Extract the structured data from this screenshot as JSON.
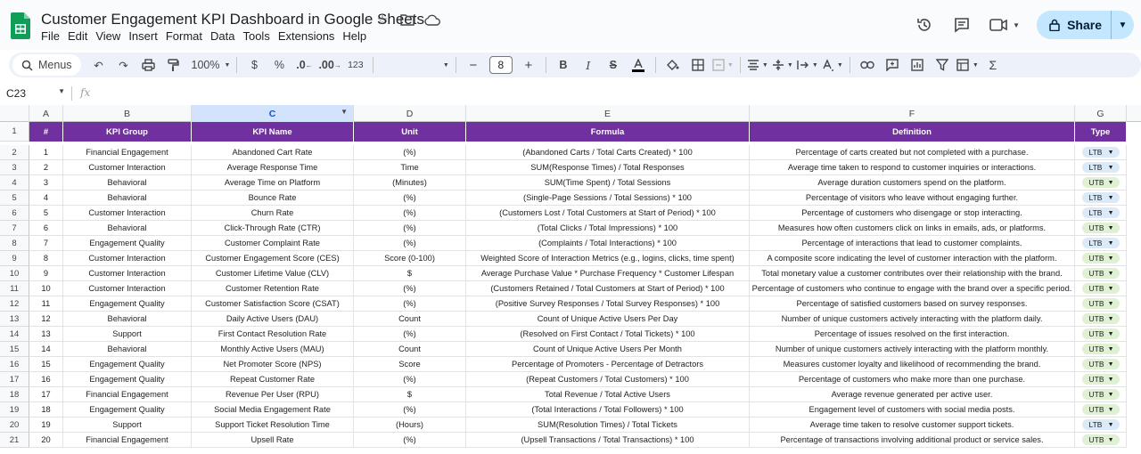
{
  "doc": {
    "title": "Customer Engagement KPI Dashboard in Google Sheets"
  },
  "menu": [
    "File",
    "Edit",
    "View",
    "Insert",
    "Format",
    "Data",
    "Tools",
    "Extensions",
    "Help"
  ],
  "share": {
    "label": "Share"
  },
  "toolbar": {
    "search_label": "Menus",
    "zoom": "100%",
    "currency": "$",
    "percent": "%",
    "dec_decrease": ".0",
    "dec_increase": ".00",
    "number_format": "123",
    "font_size": "8",
    "minus": "−",
    "plus": "+",
    "bold": "B",
    "italic": "I",
    "sigma": "Σ"
  },
  "formula_bar": {
    "cell_ref": "C23",
    "fx": "fx"
  },
  "columns": [
    "A",
    "B",
    "C",
    "D",
    "E",
    "F",
    "G"
  ],
  "headers": [
    "#",
    "KPI Group",
    "KPI Name",
    "Unit",
    "Formula",
    "Definition",
    "Type"
  ],
  "colors": {
    "header_bg": "#7030a0",
    "ltb_chip": "#dbeaf9",
    "utb_chip": "#dff0d3"
  },
  "rows": [
    {
      "n": "1",
      "group": "Financial Engagement",
      "name": "Abandoned Cart Rate",
      "unit": "(%)",
      "formula": "(Abandoned Carts / Total Carts Created) * 100",
      "definition": "Percentage of carts created but not completed with a purchase.",
      "type": "LTB"
    },
    {
      "n": "2",
      "group": "Customer Interaction",
      "name": "Average Response Time",
      "unit": "Time",
      "formula": "SUM(Response Times) / Total Responses",
      "definition": "Average time taken to respond to customer inquiries or interactions.",
      "type": "LTB"
    },
    {
      "n": "3",
      "group": "Behavioral",
      "name": "Average Time on Platform",
      "unit": "(Minutes)",
      "formula": "SUM(Time Spent) / Total Sessions",
      "definition": "Average duration customers spend on the platform.",
      "type": "UTB"
    },
    {
      "n": "4",
      "group": "Behavioral",
      "name": "Bounce Rate",
      "unit": "(%)",
      "formula": "(Single-Page Sessions / Total Sessions) * 100",
      "definition": "Percentage of visitors who leave without engaging further.",
      "type": "LTB"
    },
    {
      "n": "5",
      "group": "Customer Interaction",
      "name": "Churn Rate",
      "unit": "(%)",
      "formula": "(Customers Lost / Total Customers at Start of Period) * 100",
      "definition": "Percentage of customers who disengage or stop interacting.",
      "type": "LTB"
    },
    {
      "n": "6",
      "group": "Behavioral",
      "name": "Click-Through Rate (CTR)",
      "unit": "(%)",
      "formula": "(Total Clicks / Total Impressions) * 100",
      "definition": "Measures how often customers click on links in emails, ads, or platforms.",
      "type": "UTB"
    },
    {
      "n": "7",
      "group": "Engagement Quality",
      "name": "Customer Complaint Rate",
      "unit": "(%)",
      "formula": "(Complaints / Total Interactions) * 100",
      "definition": "Percentage of interactions that lead to customer complaints.",
      "type": "LTB"
    },
    {
      "n": "8",
      "group": "Customer Interaction",
      "name": "Customer Engagement Score (CES)",
      "unit": "Score (0-100)",
      "formula": "Weighted Score of Interaction Metrics (e.g., logins, clicks, time spent)",
      "definition": "A composite score indicating the level of customer interaction with the platform.",
      "type": "UTB"
    },
    {
      "n": "9",
      "group": "Customer Interaction",
      "name": "Customer Lifetime Value (CLV)",
      "unit": "$",
      "formula": "Average Purchase Value * Purchase Frequency * Customer Lifespan",
      "definition": "Total monetary value a customer contributes over their relationship with the brand.",
      "type": "UTB"
    },
    {
      "n": "10",
      "group": "Customer Interaction",
      "name": "Customer Retention Rate",
      "unit": "(%)",
      "formula": "(Customers Retained / Total Customers at Start of Period) * 100",
      "definition": "Percentage of customers who continue to engage with the brand over a specific period.",
      "type": "UTB"
    },
    {
      "n": "11",
      "group": "Engagement Quality",
      "name": "Customer Satisfaction Score (CSAT)",
      "unit": "(%)",
      "formula": "(Positive Survey Responses / Total Survey Responses) * 100",
      "definition": "Percentage of satisfied customers based on survey responses.",
      "type": "UTB"
    },
    {
      "n": "12",
      "group": "Behavioral",
      "name": "Daily Active Users (DAU)",
      "unit": "Count",
      "formula": "Count of Unique Active Users Per Day",
      "definition": "Number of unique customers actively interacting with the platform daily.",
      "type": "UTB"
    },
    {
      "n": "13",
      "group": "Support",
      "name": "First Contact Resolution Rate",
      "unit": "(%)",
      "formula": "(Resolved on First Contact / Total Tickets) * 100",
      "definition": "Percentage of issues resolved on the first interaction.",
      "type": "UTB"
    },
    {
      "n": "14",
      "group": "Behavioral",
      "name": "Monthly Active Users (MAU)",
      "unit": "Count",
      "formula": "Count of Unique Active Users Per Month",
      "definition": "Number of unique customers actively interacting with the platform monthly.",
      "type": "UTB"
    },
    {
      "n": "15",
      "group": "Engagement Quality",
      "name": "Net Promoter Score (NPS)",
      "unit": "Score",
      "formula": "Percentage of Promoters - Percentage of Detractors",
      "definition": "Measures customer loyalty and likelihood of recommending the brand.",
      "type": "UTB"
    },
    {
      "n": "16",
      "group": "Engagement Quality",
      "name": "Repeat Customer Rate",
      "unit": "(%)",
      "formula": "(Repeat Customers / Total Customers) * 100",
      "definition": "Percentage of customers who make more than one purchase.",
      "type": "UTB"
    },
    {
      "n": "17",
      "group": "Financial Engagement",
      "name": "Revenue Per User (RPU)",
      "unit": "$",
      "formula": "Total Revenue / Total Active Users",
      "definition": "Average revenue generated per active user.",
      "type": "UTB"
    },
    {
      "n": "18",
      "group": "Engagement Quality",
      "name": "Social Media Engagement Rate",
      "unit": "(%)",
      "formula": "(Total Interactions / Total Followers) * 100",
      "definition": "Engagement level of customers with social media posts.",
      "type": "UTB"
    },
    {
      "n": "19",
      "group": "Support",
      "name": "Support Ticket Resolution Time",
      "unit": "(Hours)",
      "formula": "SUM(Resolution Times) / Total Tickets",
      "definition": "Average time taken to resolve customer support tickets.",
      "type": "LTB"
    },
    {
      "n": "20",
      "group": "Financial Engagement",
      "name": "Upsell Rate",
      "unit": "(%)",
      "formula": "(Upsell Transactions / Total Transactions) * 100",
      "definition": "Percentage of transactions involving additional product or service sales.",
      "type": "UTB"
    }
  ]
}
